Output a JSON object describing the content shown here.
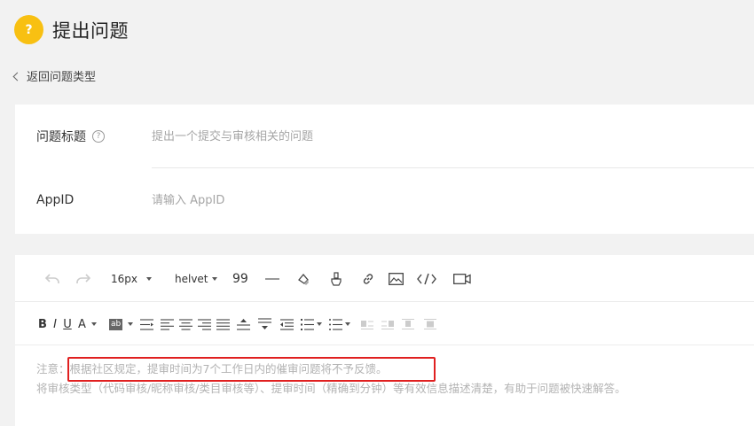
{
  "header": {
    "badge_icon": "?",
    "title": "提出问题",
    "badge_color": "#f8c012"
  },
  "back_link": {
    "label": "返回问题类型"
  },
  "form": {
    "title_field": {
      "label": "问题标题",
      "help_icon": "?",
      "placeholder": "提出一个提交与审核相关的问题"
    },
    "appid_field": {
      "label": "AppID",
      "placeholder": "请输入 AppID"
    }
  },
  "toolbar": {
    "font_size": "16px",
    "font_family": "helvet",
    "quote_glyph": "99",
    "bold": "B",
    "italic": "I",
    "underline": "U",
    "font_color": "A",
    "highlight": "ab"
  },
  "editor": {
    "note_prefix": "注意：",
    "note_text": "根据社区规定，提审时间为7个工作日内的催审问题将不予反馈。",
    "hint_text": "将审核类型（代码审核/昵称审核/类目审核等）、提审时间（精确到分钟）等有效信息描述清楚，有助于问题被快速解答。"
  },
  "colors": {
    "highlight_border": "#e02020",
    "placeholder": "#a6a6a6"
  }
}
